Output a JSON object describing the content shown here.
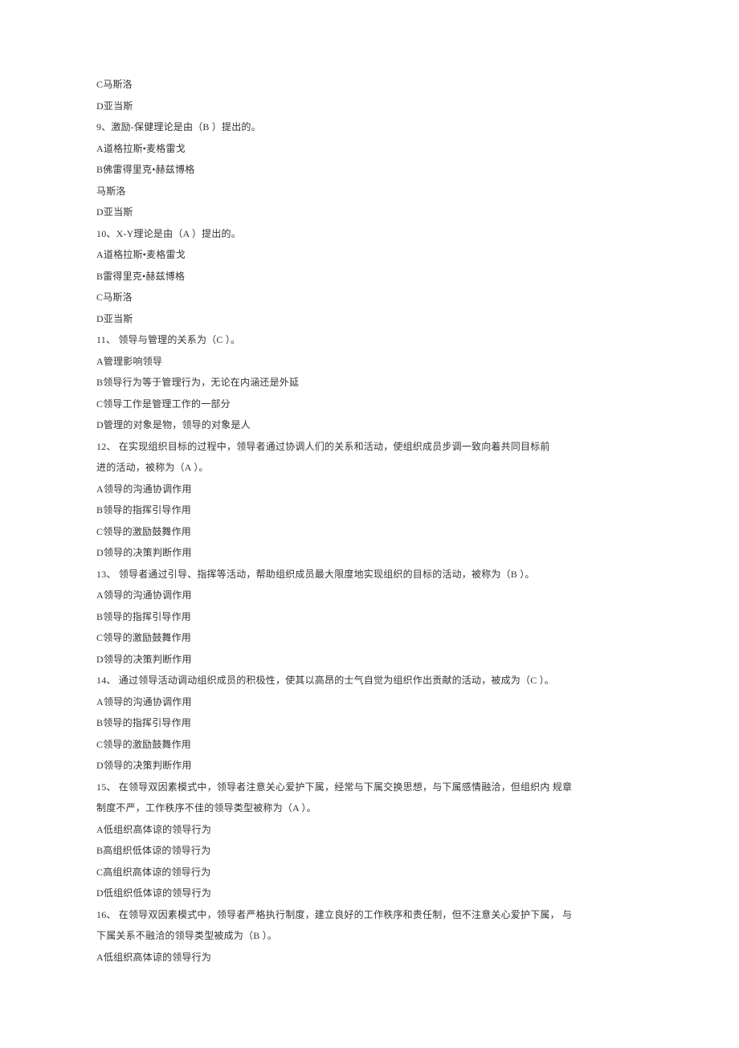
{
  "lines": [
    "C马斯洛",
    "D亚当斯",
    "9、激励-保健理论是由（B ）提出的。",
    "A道格拉斯•麦格雷戈",
    "B佛雷得里克•赫兹博格",
    "马斯洛",
    "D亚当斯",
    "10、X-Y理论是由（A ）提出的。",
    "A道格拉斯•麦格雷戈",
    "B雷得里克•赫兹博格",
    "C马斯洛",
    "D亚当斯",
    "11、 领导与管理的关系为（C ）。",
    "A管理影响领导",
    "B领导行为等于管理行为，无论在内涵还是外延",
    "C领导工作是管理工作的一部分",
    "D管理的对象是物，领导的对象是人",
    "12、 在实现组织目标的过程中，领导者通过协调人们的关系和活动，使组织成员步调一致向着共同目标前",
    "进的活动，被称为（A ）。",
    "A领导的沟通协调作用",
    "B领导的指挥引导作用",
    "C领导的激励鼓舞作用",
    "D领导的决策判断作用",
    "13、 领导者通过引导、指挥等活动，帮助组织成员最大限度地实现组织的目标的活动，被称为（B ）。",
    "A领导的沟通协调作用",
    "B领导的指挥引导作用",
    "C领导的激励鼓舞作用",
    "D领导的决策判断作用",
    "14、 通过领导活动调动组织成员的积极性，使其以高昂的士气自觉为组织作出贡献的活动，被成为（C ）。",
    "A领导的沟通协调作用",
    "B领导的指挥引导作用",
    "C领导的激励鼓舞作用",
    "D领导的决策判断作用",
    "15、 在领导双因素模式中，领导者注意关心爱护下属，经常与下属交换思想，与下属感情融洽，但组织内 规章",
    "制度不严，工作秩序不佳的领导类型被称为（A ）。",
    "A低组织高体谅的领导行为",
    "B高组织低体谅的领导行为",
    "C高组织高体谅的领导行为",
    "D低组织低体谅的领导行为",
    "16、 在领导双因素模式中，领导者严格执行制度，建立良好的工作秩序和责任制，但不注意关心爱护下属， 与",
    "下属关系不融洽的领导类型被成为（B ）。",
    "A低组织高体谅的领导行为"
  ]
}
